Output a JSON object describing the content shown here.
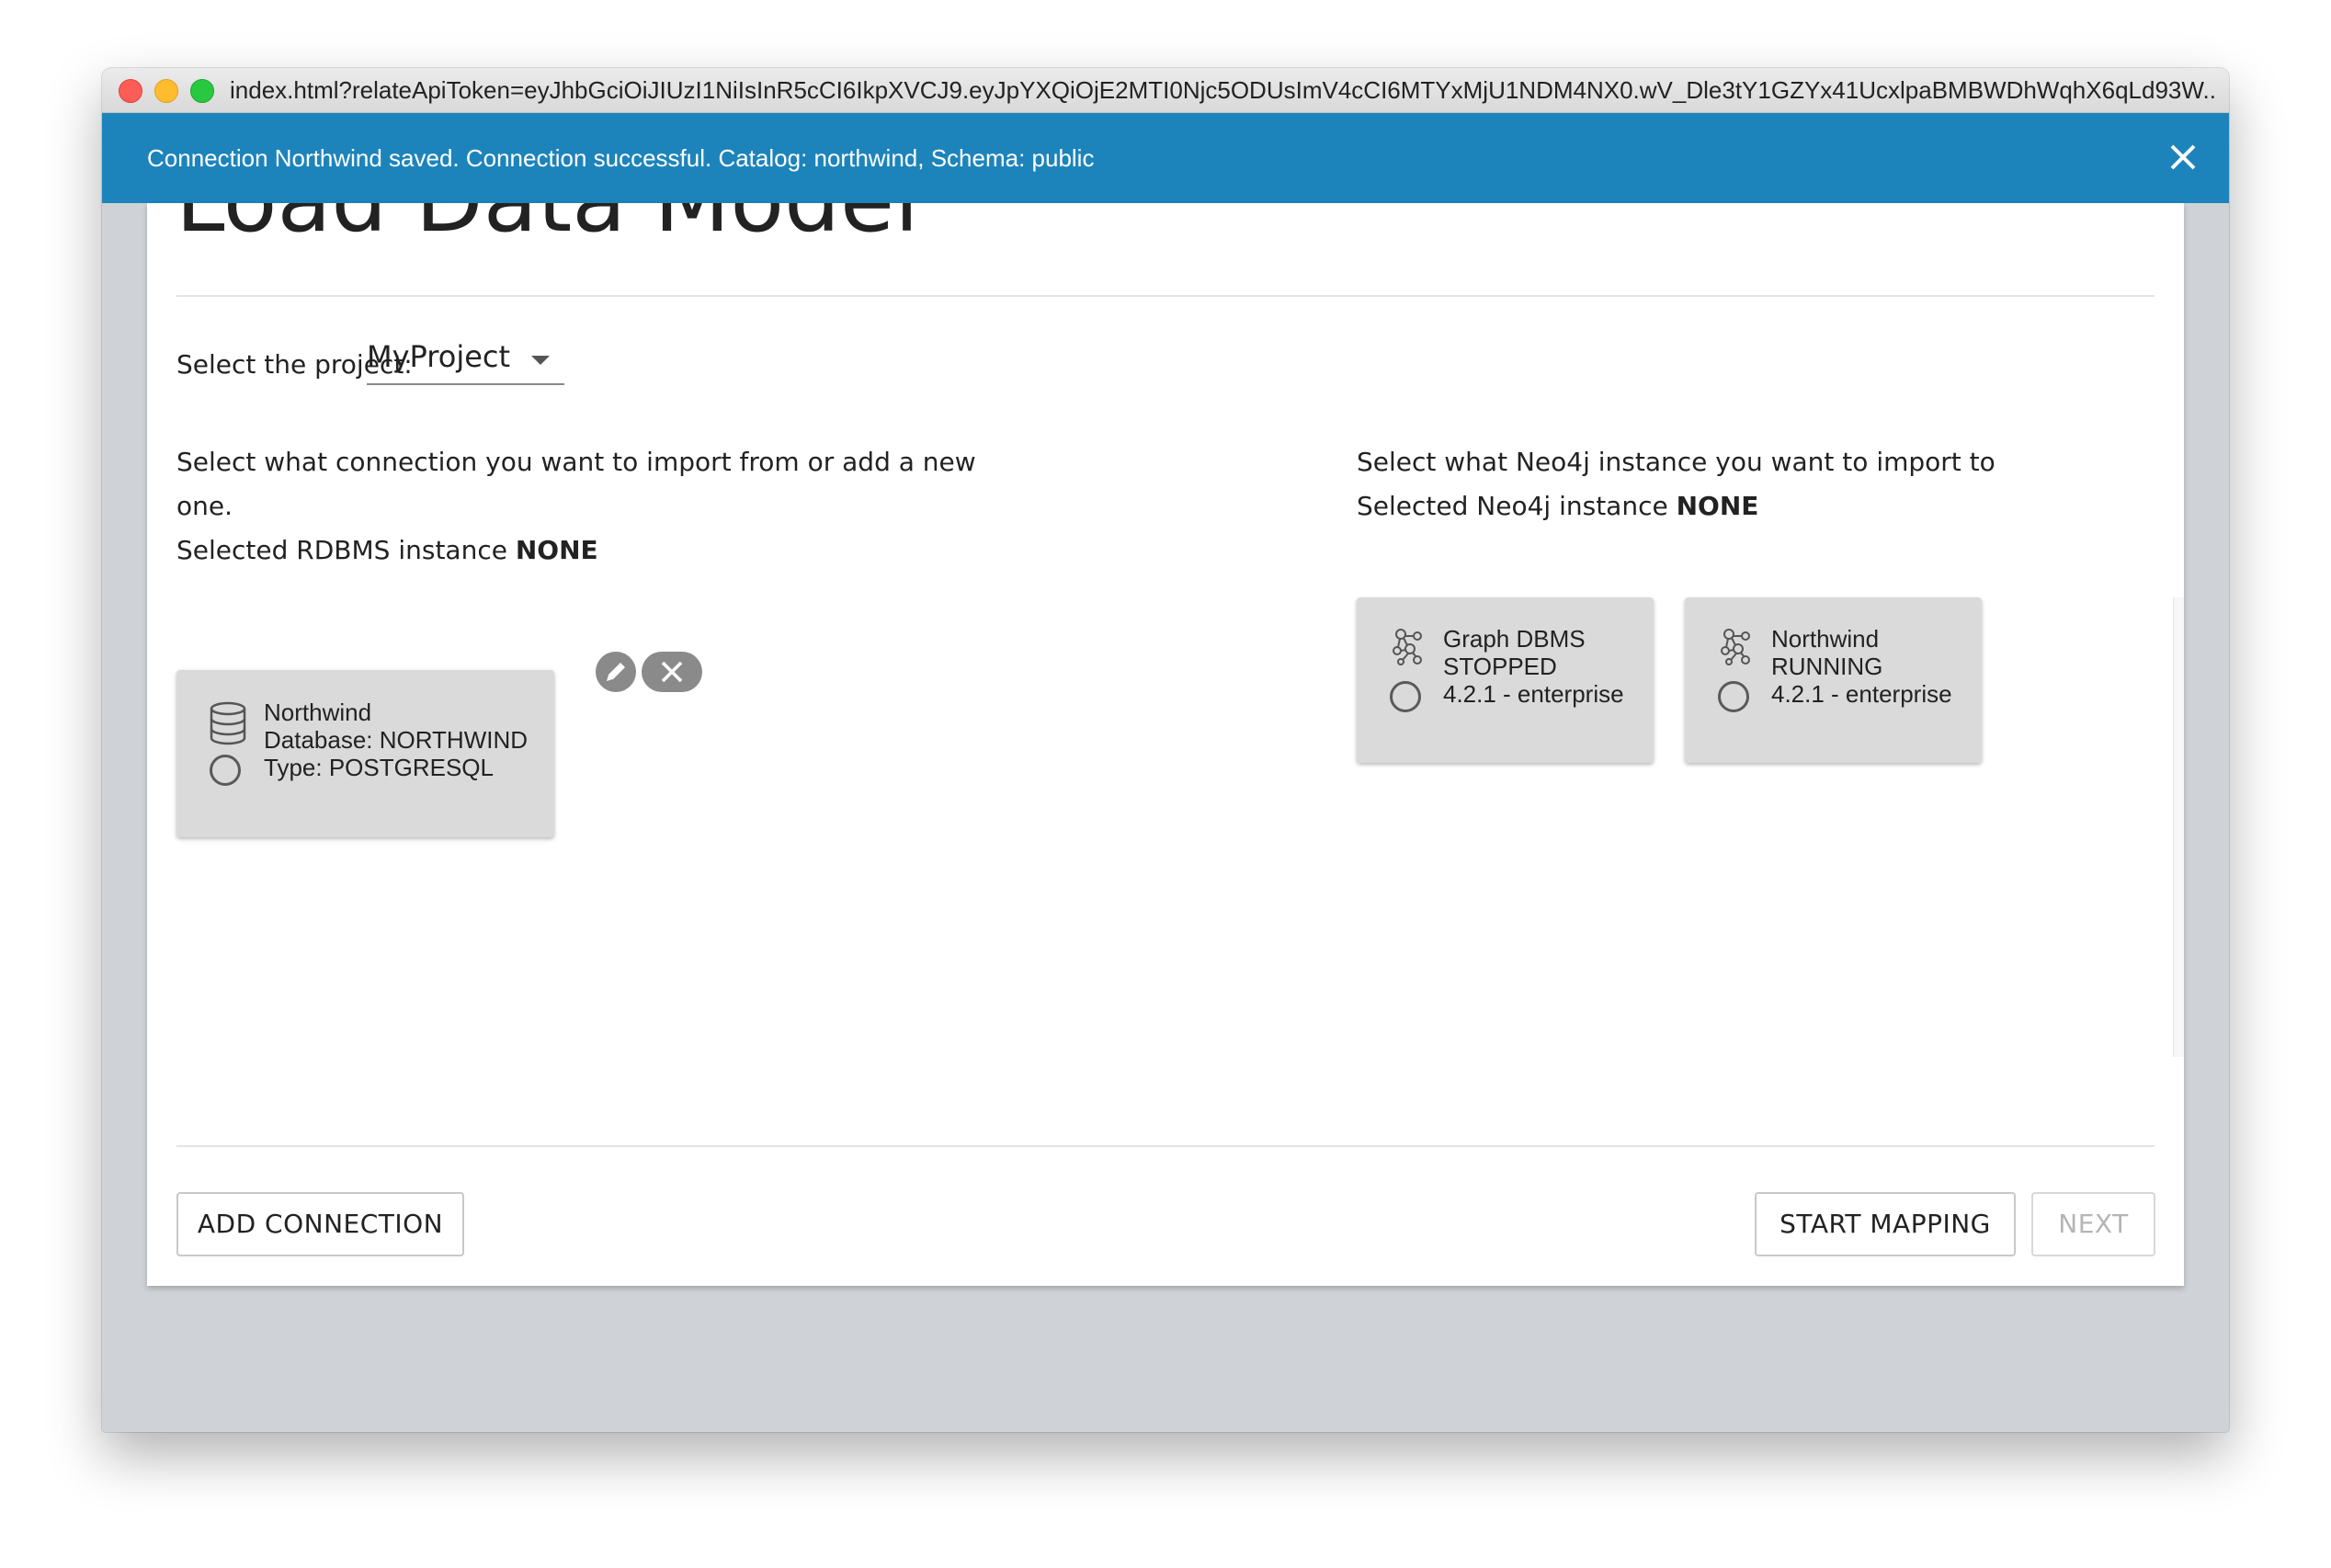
{
  "window": {
    "url": "index.html?relateApiToken=eyJhbGciOiJIUzI1NiIsInR5cCI6IkpXVCJ9.eyJpYXQiOjE2MTI0Njc5ODUsImV4cCI6MTYxMjU1NDM4NX0.wV_Dle3tY1GZYx41UcxlpaBMBWDhWqhX6qLd93W..."
  },
  "notification": {
    "message": "Connection Northwind saved. Connection successful. Catalog: northwind, Schema: public"
  },
  "page": {
    "title": "Load Data Model"
  },
  "project": {
    "label": "Select the project:",
    "selected": "MyProject"
  },
  "rdbms": {
    "prompt_line1": "Select what connection you want to import from or add a new",
    "prompt_line2": "one.",
    "selected_label": "Selected RDBMS instance",
    "selected_value": "NONE",
    "connections": [
      {
        "name": "Northwind",
        "database": "Database: NORTHWIND",
        "type": "Type: POSTGRESQL"
      }
    ]
  },
  "neo4j": {
    "prompt": "Select what Neo4j instance you want to import to",
    "selected_label": "Selected Neo4j instance",
    "selected_value": "NONE",
    "instances": [
      {
        "name": "Graph DBMS",
        "status": "STOPPED",
        "version": "4.2.1 - enterprise"
      },
      {
        "name": "Northwind",
        "status": "RUNNING",
        "version": "4.2.1 - enterprise"
      }
    ]
  },
  "actions": {
    "add_connection": "ADD CONNECTION",
    "start_mapping": "START MAPPING",
    "next": "NEXT"
  },
  "icons": {
    "database": "database-icon",
    "neo4j": "neo4j-graph-icon",
    "edit": "pencil-icon",
    "delete": "close-icon"
  }
}
